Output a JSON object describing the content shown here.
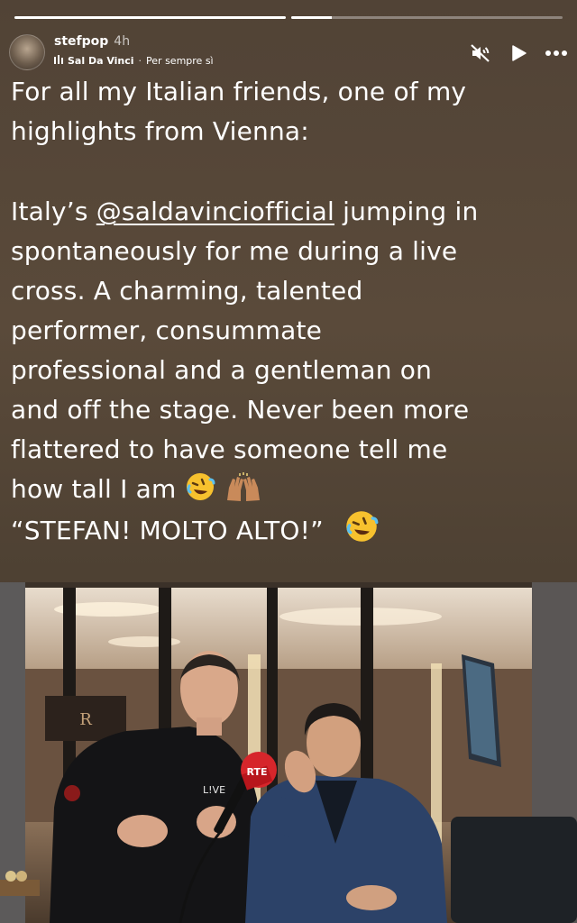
{
  "progress": [
    1.0,
    0.15
  ],
  "header": {
    "username": "stefpop",
    "time": "4h",
    "music_artist": "Sal Da Vinci",
    "music_title": "Per sempre sì",
    "separator": "·"
  },
  "icons": {
    "mute": "muted-speaker-icon",
    "play": "play-icon",
    "more": "more-options-icon",
    "music": "music-bars-icon"
  },
  "caption": {
    "line1": "For all my Italian friends, one of my",
    "line2": "highlights from Vienna:",
    "line3_pre": "Italy’s ",
    "line3_mention": "@saldavinciofficial",
    "line3_post": " jumping in",
    "line4": "spontaneously for me during a live",
    "line5": "cross. A charming, talented",
    "line6": "performer,  consummate",
    "line7": "professional and a gentleman on",
    "line8": "and off the stage. Never been more",
    "line9": "flattered to have someone tell me",
    "line10": "how tall I am",
    "line11": "“STEFAN! MOLTO ALTO!”"
  },
  "photo": {
    "mic_flag_text": "RTE",
    "shirt_text": "L!VE",
    "background_sign": "R"
  },
  "colors": {
    "story_bg": "#54463a",
    "text": "#ffffff",
    "mic_red": "#d6262b"
  }
}
